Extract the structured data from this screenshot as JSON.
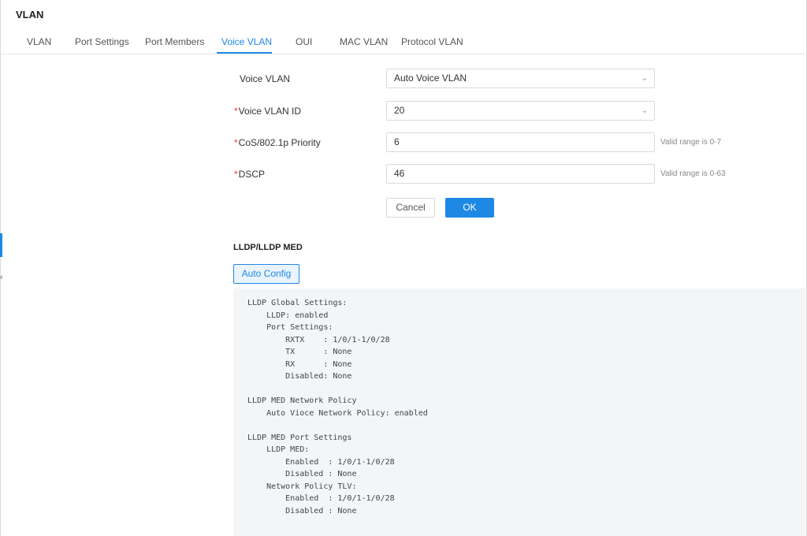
{
  "page": {
    "title": "VLAN"
  },
  "tabs": [
    {
      "label": "VLAN",
      "active": false
    },
    {
      "label": "Port Settings",
      "active": false
    },
    {
      "label": "Port Members",
      "active": false
    },
    {
      "label": "Voice VLAN",
      "active": true
    },
    {
      "label": "OUI",
      "active": false
    },
    {
      "label": "MAC VLAN",
      "active": false
    },
    {
      "label": "Protocol VLAN",
      "active": false
    }
  ],
  "sidebar": {
    "collapse_glyph": "‹"
  },
  "form": {
    "voice_vlan": {
      "label": "Voice VLAN",
      "value": "Auto Voice VLAN"
    },
    "voice_vlan_id": {
      "label": "Voice VLAN ID",
      "required_mark": "*",
      "value": "20"
    },
    "cos_priority": {
      "label": "CoS/802.1p Priority",
      "required_mark": "*",
      "value": "6",
      "hint": "Valid range is 0-7"
    },
    "dscp": {
      "label": "DSCP",
      "required_mark": "*",
      "value": "46",
      "hint": "Valid range is 0-63"
    },
    "cancel_label": "Cancel",
    "ok_label": "OK"
  },
  "lldp": {
    "section_title": "LLDP/LLDP MED",
    "auto_config_label": "Auto Config",
    "lines": [
      "LLDP Global Settings:",
      "    LLDP: enabled",
      "    Port Settings:",
      "        RXTX    : 1/0/1-1/0/28",
      "        TX      : None",
      "        RX      : None",
      "        Disabled: None",
      "",
      "LLDP MED Network Policy",
      "    Auto Vioce Network Policy: enabled",
      "",
      "LLDP MED Port Settings",
      "    LLDP MED:",
      "        Enabled  : 1/0/1-1/0/28",
      "        Disabled : None",
      "    Network Policy TLV:",
      "        Enabled  : 1/0/1-1/0/28",
      "        Disabled : None"
    ]
  },
  "colors": {
    "accent": "#1e88e5",
    "required": "#e53935",
    "code_bg": "#f3f5f7"
  }
}
